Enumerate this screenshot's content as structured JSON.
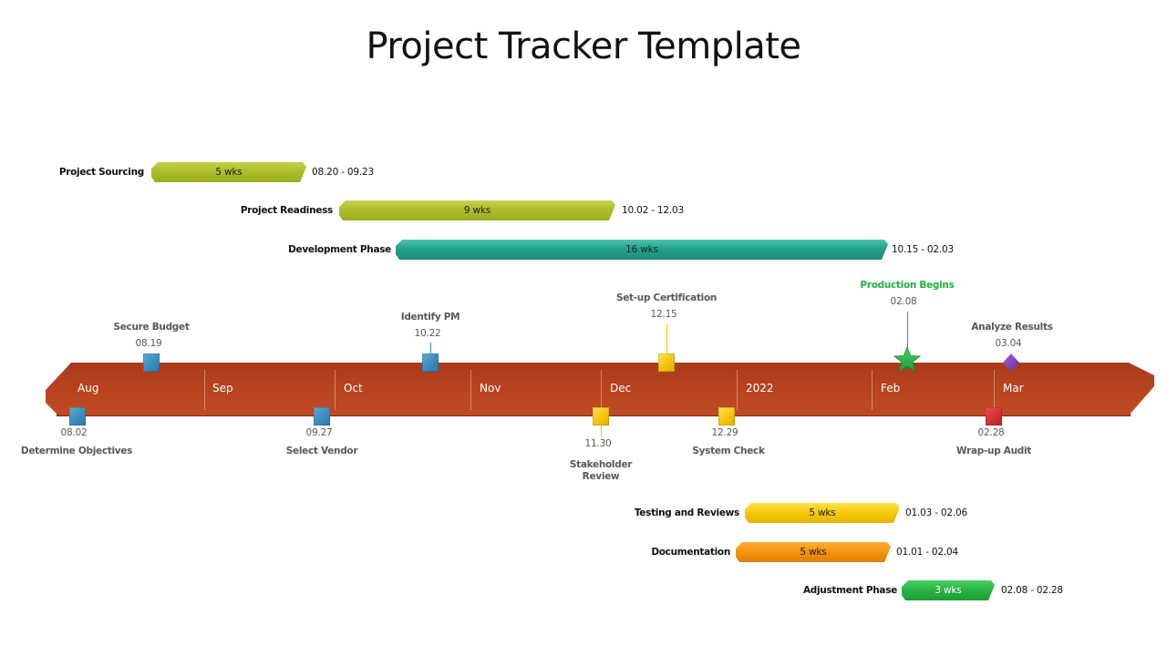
{
  "title": "Project Tracker Template",
  "colors": {
    "timeline": "#b8441f",
    "olive": "#aebd2b",
    "teal": "#23a38a",
    "yellow": "#f6c80a",
    "orange": "#f39410",
    "green": "#28b342",
    "milestone_blue": "#3c8cbf",
    "milestone_yellow": "#f5c40d",
    "milestone_red": "#d03232",
    "milestone_purple": "#7d3cb5",
    "production_green": "#22b040"
  },
  "timeline": {
    "months": [
      "Aug",
      "Sep",
      "Oct",
      "Nov",
      "Dec",
      "2022",
      "Feb",
      "Mar"
    ]
  },
  "tasks_top": [
    {
      "name": "Project Sourcing",
      "duration": "5 wks",
      "range": "08.20 - 09.23",
      "color": "olive"
    },
    {
      "name": "Project Readiness",
      "duration": "9 wks",
      "range": "10.02 - 12.03",
      "color": "olive"
    },
    {
      "name": "Development Phase",
      "duration": "16 wks",
      "range": "10.15 - 02.03",
      "color": "teal"
    }
  ],
  "tasks_bottom": [
    {
      "name": "Testing and Reviews",
      "duration": "5 wks",
      "range": "01.03 - 02.06",
      "color": "yellow"
    },
    {
      "name": "Documentation",
      "duration": "5 wks",
      "range": "01.01 - 02.04",
      "color": "orange"
    },
    {
      "name": "Adjustment Phase",
      "duration": "3 wks",
      "range": "02.08 - 02.28",
      "color": "green"
    }
  ],
  "milestones_above": [
    {
      "name": "Secure Budget",
      "date": "08.19",
      "shape": "square",
      "color": "blue"
    },
    {
      "name": "Identify PM",
      "date": "10.22",
      "shape": "square",
      "color": "blue"
    },
    {
      "name": "Set-up Certification",
      "date": "12.15",
      "shape": "square",
      "color": "yellow"
    },
    {
      "name": "Production Begins",
      "date": "02.08",
      "shape": "star",
      "color": "green"
    },
    {
      "name": "Analyze Results",
      "date": "03.04",
      "shape": "diamond",
      "color": "purple"
    }
  ],
  "milestones_below": [
    {
      "name": "Determine Objectives",
      "date": "08.02",
      "shape": "square",
      "color": "blue"
    },
    {
      "name": "Select Vendor",
      "date": "09.27",
      "shape": "square",
      "color": "blue"
    },
    {
      "name": "Stakeholder",
      "name2": "Review",
      "date": "11.30",
      "shape": "square",
      "color": "yellow"
    },
    {
      "name": "System Check",
      "date": "12.29",
      "shape": "square",
      "color": "yellow"
    },
    {
      "name": "Wrap-up Audit",
      "date": "02.28",
      "shape": "square",
      "color": "red"
    }
  ]
}
